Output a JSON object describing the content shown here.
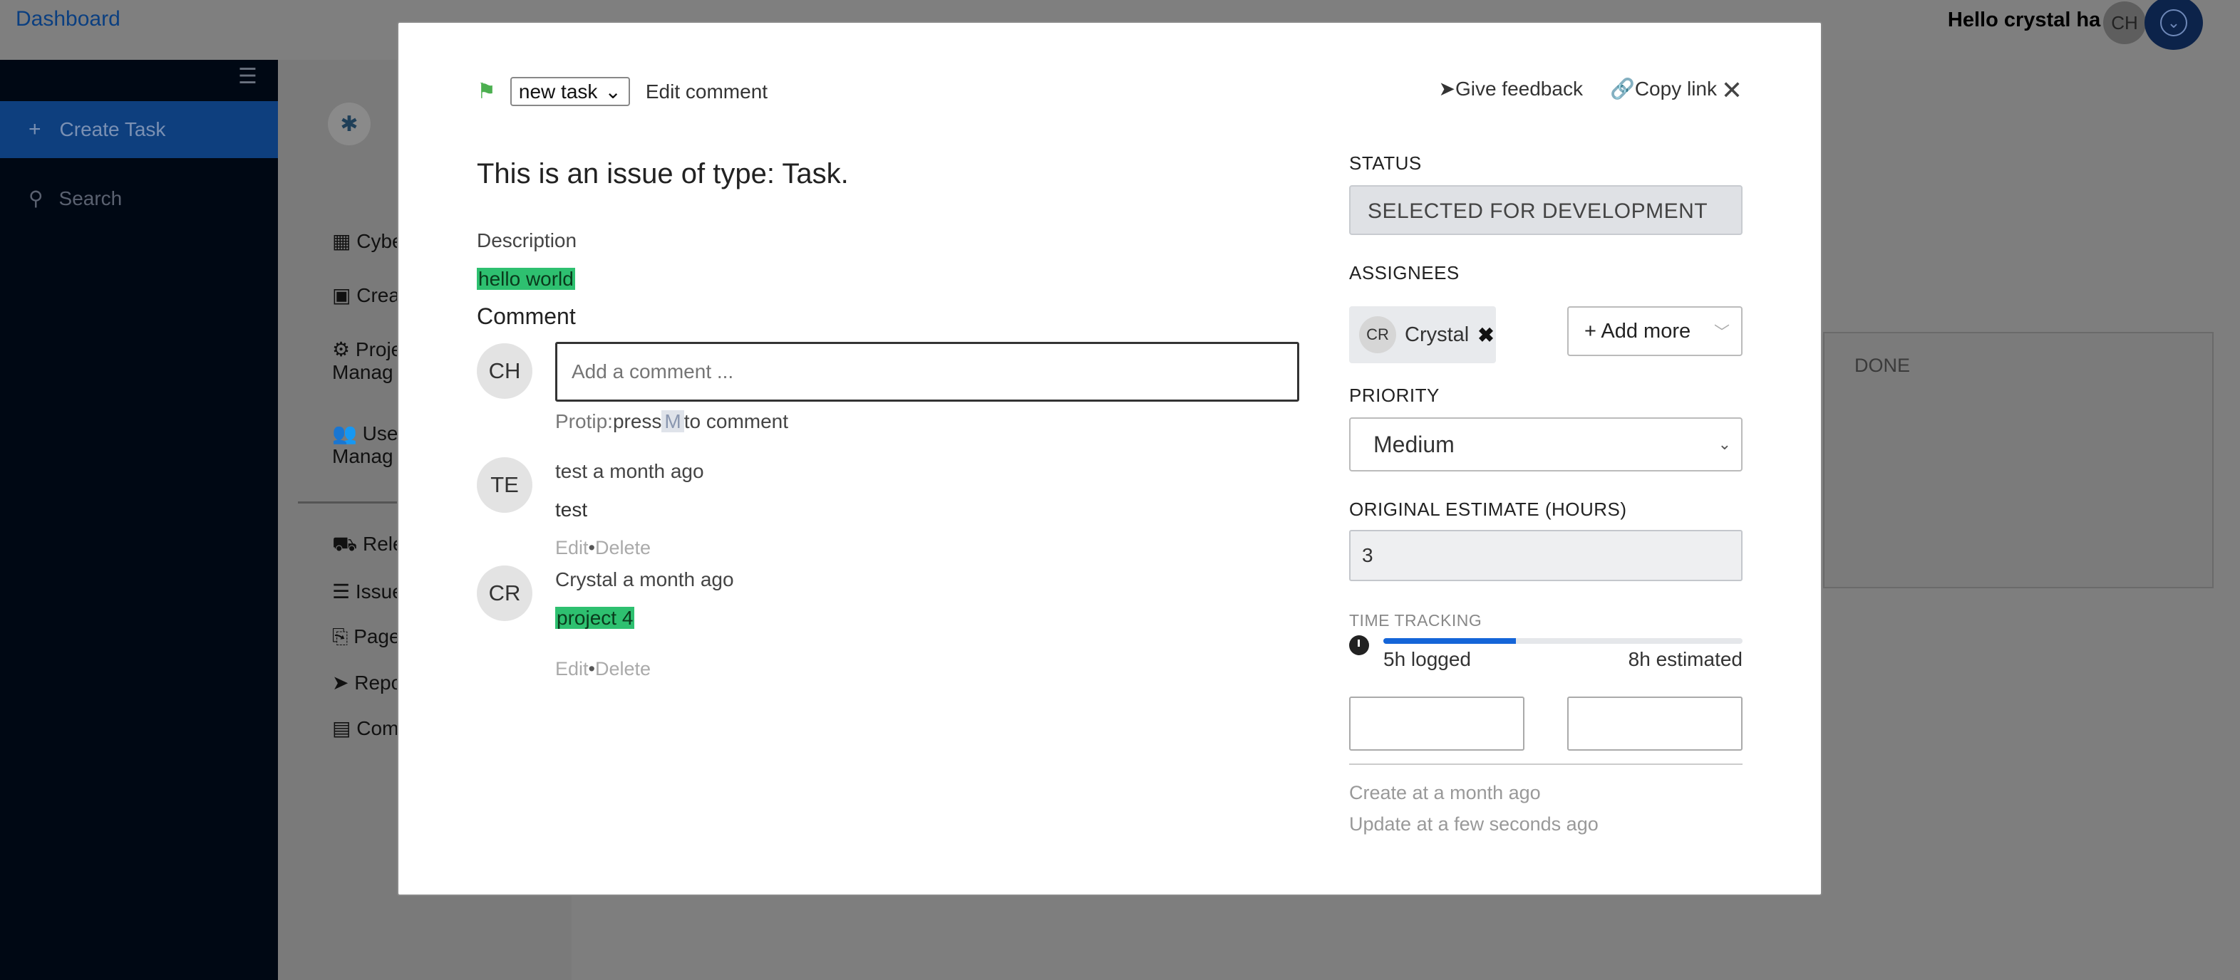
{
  "topbar": {
    "brand": "Dashboard",
    "greeting": "Hello crystal ha !",
    "avatar": "CH"
  },
  "sidebar": {
    "create_task": "Create Task",
    "search": "Search"
  },
  "inner_nav": [
    "Cybe",
    "Crea",
    "Proje\nManag",
    "Use\nManag",
    "Rele",
    "Issue",
    "Page",
    "Repo",
    "Com"
  ],
  "board": {
    "done_label": "DONE"
  },
  "modal": {
    "type": "new task",
    "edit_comment": "Edit comment",
    "give_feedback": "Give feedback",
    "copy_link": "Copy link",
    "title": "This is an issue of type: Task.",
    "description_label": "Description",
    "description": "hello world",
    "comment_label": "Comment",
    "current_user_avatar": "CH",
    "comment_placeholder": "Add a comment ...",
    "protip": {
      "prefix": "Protip:",
      "press": "press",
      "key": "M",
      "suffix": "to comment"
    },
    "comments": [
      {
        "avatar": "TE",
        "author": "test a month ago",
        "body": "test",
        "edit": "Edit",
        "sep": "•",
        "delete": "Delete",
        "highlight": false
      },
      {
        "avatar": "CR",
        "author": "Crystal a month ago",
        "body": "project 4",
        "edit": "Edit",
        "sep": "•",
        "delete": "Delete",
        "highlight": true
      }
    ],
    "status_label": "STATUS",
    "status": "SELECTED FOR DEVELOPMENT",
    "assignees_label": "ASSIGNEES",
    "assignee": {
      "avatar": "CR",
      "name": "Crystal"
    },
    "add_more": "+ Add more",
    "priority_label": "PRIORITY",
    "priority": "Medium",
    "estimate_label": "ORIGINAL ESTIMATE (HOURS)",
    "estimate": "3",
    "time_tracking_label": "TIME TRACKING",
    "time_logged": "5h logged",
    "time_estimated": "8h estimated",
    "time_progress": 0.37,
    "created": "Create at a month ago",
    "updated": "Update at a few seconds ago"
  },
  "colors": {
    "accent": "#1565d8",
    "highlight": "#2ec070",
    "flag": "#4caf50",
    "sidebar": "#000814"
  }
}
